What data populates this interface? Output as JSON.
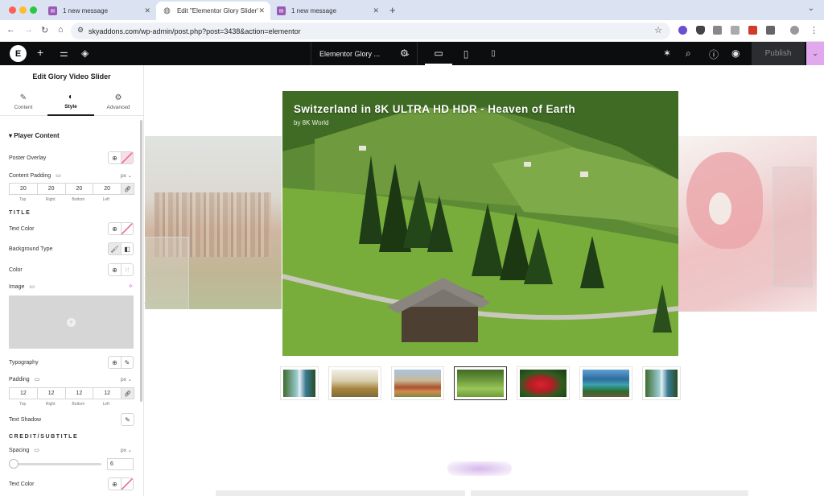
{
  "browser": {
    "tabs": [
      {
        "title": "1 new message",
        "icon": "mail-icon"
      },
      {
        "title": "Edit \"Elementor Glory Slider\"",
        "icon": "globe-icon"
      },
      {
        "title": "1 new message",
        "icon": "mail-icon"
      }
    ],
    "active_tab": 1,
    "new_tab_label": "+",
    "url": "skyaddons.com/wp-admin/post.php?post=3438&action=elementor"
  },
  "editor": {
    "document_title": "Elementor Glory ...",
    "publish_label": "Publish",
    "panel_title": "Edit Glory Video Slider",
    "panel_tabs": [
      {
        "label": "Content",
        "icon": "pencil-icon"
      },
      {
        "label": "Style",
        "icon": "contrast-icon"
      },
      {
        "label": "Advanced",
        "icon": "gear-icon"
      }
    ],
    "active_panel_tab": 1,
    "section_title": "Player Content",
    "poster_overlay_label": "Poster Overlay",
    "content_padding_label": "Content Padding",
    "content_padding_unit": "px",
    "content_padding_values": [
      "20",
      "20",
      "20",
      "20"
    ],
    "dimension_labels": [
      "Top",
      "Right",
      "Bottom",
      "Left"
    ],
    "title_heading": "TITLE",
    "text_color_label": "Text Color",
    "background_type_label": "Background Type",
    "color_label": "Color",
    "image_label": "Image",
    "typography_label": "Typography",
    "padding_label": "Padding",
    "padding_unit": "px",
    "padding_values": [
      "12",
      "12",
      "12",
      "12"
    ],
    "text_shadow_label": "Text Shadow",
    "credit_heading": "CREDIT/SUBTITLE",
    "spacing_label": "Spacing",
    "spacing_unit": "px",
    "spacing_value": "6",
    "credit_text_color_label": "Text Color"
  },
  "slider": {
    "video_title": "Switzerland in 8K ULTRA HD HDR - Heaven of Earth",
    "credit": "by 8K World",
    "thumbnails": [
      "waterfall",
      "safari",
      "horses",
      "alpine-hut",
      "parrot",
      "river-valley",
      "waterfall"
    ],
    "active_thumbnail": 3
  },
  "colors": {
    "accent_pink": "#e2a8ee",
    "dark_bar": "#0c0d0e",
    "tab_strip": "#dbe3f3"
  }
}
